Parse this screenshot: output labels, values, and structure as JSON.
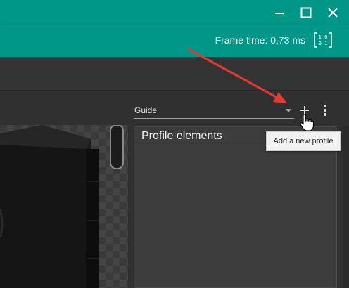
{
  "window": {
    "controls": [
      "minimize-icon",
      "maximize-icon",
      "close-icon"
    ]
  },
  "appbar": {
    "frame_time": "Frame time: 0,73 ms",
    "binary_icon": "binary-toggle-icon"
  },
  "profile": {
    "guide_value": "Guide",
    "add_icon": "plus-icon",
    "more_icon": "more-vertical-icon",
    "panel_title": "Profile elements",
    "tooltip": "Add a new profile"
  },
  "colors": {
    "accent": "#009688",
    "annotation_arrow": "#e53935",
    "tooltip_bg": "#f2f2f2"
  }
}
